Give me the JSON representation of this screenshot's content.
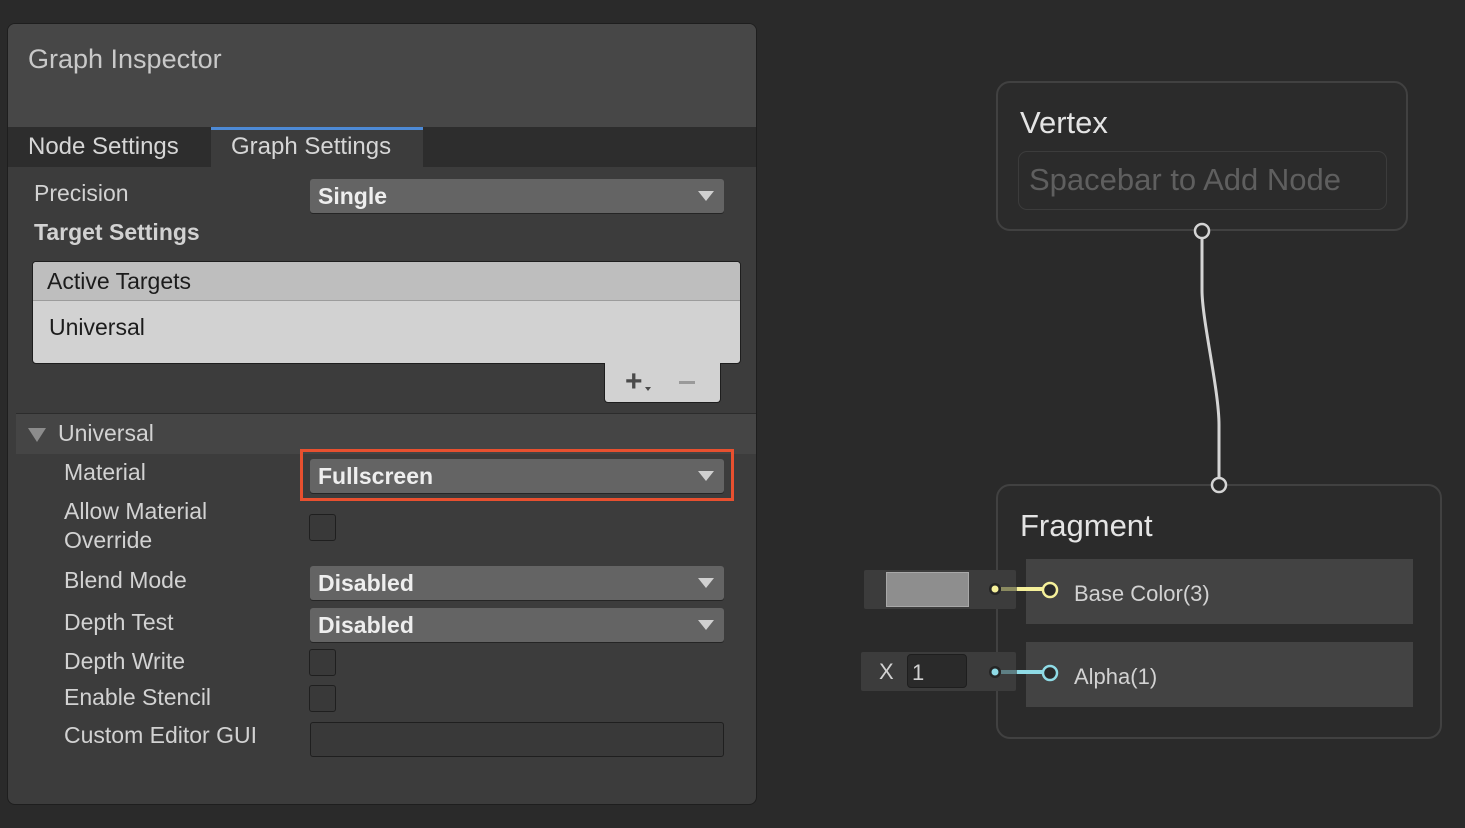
{
  "inspector": {
    "title": "Graph Inspector",
    "tabs": [
      {
        "label": "Node Settings",
        "active": false
      },
      {
        "label": "Graph Settings",
        "active": true
      }
    ],
    "precision": {
      "label": "Precision",
      "value": "Single"
    },
    "target_settings_label": "Target Settings",
    "active_targets": {
      "header": "Active Targets",
      "items": [
        "Universal"
      ],
      "add_icon": "plus-icon",
      "remove_icon": "minus-icon"
    },
    "universal_section": {
      "label": "Universal",
      "expanded": true,
      "material": {
        "label": "Material",
        "value": "Fullscreen",
        "highlighted": true
      },
      "allow_material_override": {
        "label_line1": "Allow Material",
        "label_line2": "Override",
        "checked": false
      },
      "blend_mode": {
        "label": "Blend Mode",
        "value": "Disabled"
      },
      "depth_test": {
        "label": "Depth Test",
        "value": "Disabled"
      },
      "depth_write": {
        "label": "Depth Write",
        "checked": false
      },
      "enable_stencil": {
        "label": "Enable Stencil",
        "checked": false
      },
      "custom_editor_gui": {
        "label": "Custom Editor GUI",
        "value": ""
      }
    }
  },
  "graph": {
    "vertex": {
      "title": "Vertex",
      "placeholder": "Spacebar to Add Node"
    },
    "fragment": {
      "title": "Fragment",
      "ports": [
        {
          "label": "Base Color(3)",
          "color": "#f5f09a",
          "input": {
            "type": "color",
            "value": "#8e8e8e"
          }
        },
        {
          "label": "Alpha(1)",
          "color": "#8fdbe6",
          "input": {
            "type": "float",
            "axis": "X",
            "value": "1"
          }
        }
      ]
    }
  },
  "colors": {
    "highlight": "#e8502f",
    "active_tab_accent": "#4d8ad6"
  }
}
